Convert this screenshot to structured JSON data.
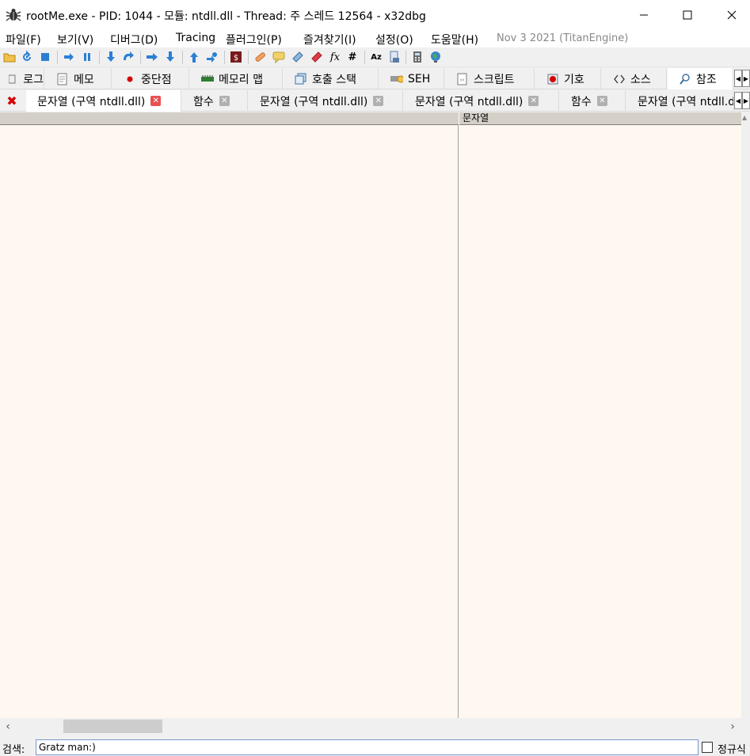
{
  "window": {
    "title": "rootMe.exe - PID: 1044 - 모듈: ntdll.dll - Thread: 주 스레드 12564 - x32dbg",
    "icon": "bug-icon",
    "controls": {
      "minimize": "—",
      "maximize": "☐",
      "close": "✕"
    }
  },
  "menubar": {
    "items": [
      "파일(F)",
      "보기(V)",
      "디버그(D)",
      "Tracing",
      "플러그인(P)",
      "즐겨찾기(I)",
      "설정(O)",
      "도움말(H)"
    ],
    "version": "Nov 3 2021 (TitanEngine)"
  },
  "toolbar": {
    "icons": [
      "open-icon",
      "restart-icon",
      "stop-icon",
      "run-icon",
      "pause-icon",
      "step-into-icon",
      "step-over-icon",
      "trace-into-icon",
      "trace-over-icon",
      "execute-till-return-icon",
      "run-to-user-code-icon",
      "script-icon",
      "patch-icon",
      "comment-icon",
      "label-icon",
      "bookmark-icon",
      "function-icon",
      "hash-icon",
      "font-icon",
      "module-icon",
      "calculator-icon",
      "globe-icon"
    ]
  },
  "main_tabs": [
    {
      "label": "로그",
      "icon": "log-icon"
    },
    {
      "label": "메모",
      "icon": "notes-icon"
    },
    {
      "label": "중단점",
      "icon": "breakpoint-icon"
    },
    {
      "label": "메모리 맵",
      "icon": "memory-map-icon"
    },
    {
      "label": "호출 스택",
      "icon": "call-stack-icon"
    },
    {
      "label": "SEH",
      "icon": "seh-icon"
    },
    {
      "label": "스크립트",
      "icon": "script-icon"
    },
    {
      "label": "기호",
      "icon": "symbols-icon"
    },
    {
      "label": "소스",
      "icon": "source-icon"
    },
    {
      "label": "참조",
      "icon": "references-icon"
    }
  ],
  "sub_tabs": [
    {
      "label": "문자열 (구역 ntdll.dll)",
      "active": true
    },
    {
      "label": "함수"
    },
    {
      "label": "문자열 (구역 ntdll.dll)"
    },
    {
      "label": "문자열 (구역 ntdll.dll)"
    },
    {
      "label": "함수"
    },
    {
      "label": "문자열 (구역 ntdll.dll)"
    }
  ],
  "references_view": {
    "column_header": "문자열"
  },
  "search": {
    "label": "검색:",
    "value": "Gratz man:)",
    "regex_label": "정규식"
  },
  "colors": {
    "content_bg": "#fff8f0",
    "active_close": "#e85050",
    "close_all": "#d40000"
  }
}
